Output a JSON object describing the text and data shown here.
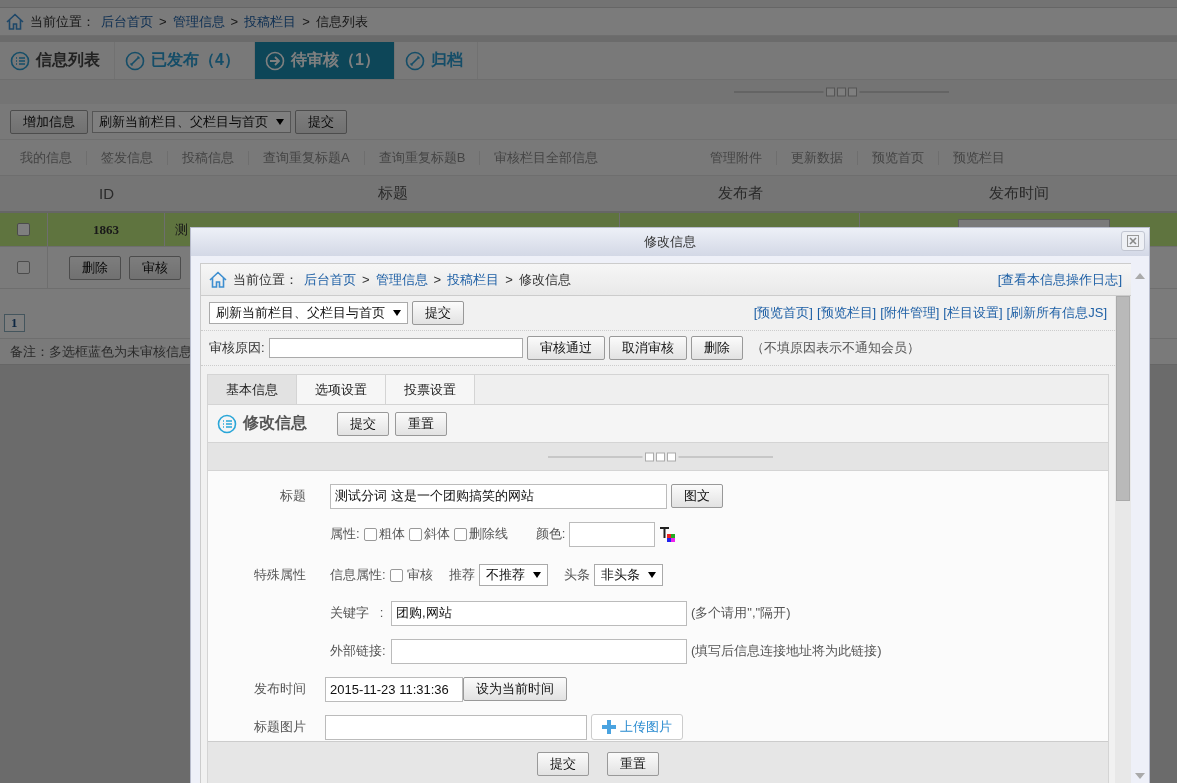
{
  "page": {
    "breadcrumb": {
      "label": "当前位置：",
      "items": [
        {
          "text": "后台首页",
          "kind": "link"
        },
        {
          "text": ">",
          "kind": "separator"
        },
        {
          "text": "管理信息",
          "kind": "link"
        },
        {
          "text": ">",
          "kind": "separator"
        },
        {
          "text": "投稿栏目",
          "kind": "link"
        },
        {
          "text": ">",
          "kind": "separator"
        },
        {
          "text": "信息列表",
          "kind": "current"
        }
      ]
    },
    "tabs": [
      {
        "label": "信息列表",
        "selected": false
      },
      {
        "label": "已发布（4）",
        "selected": false
      },
      {
        "label": "待审核（1）",
        "selected": true
      },
      {
        "label": "归档",
        "selected": false
      }
    ],
    "toolbar": {
      "add_button": "增加信息",
      "refresh_select": "刷新当前栏目、父栏目与首页",
      "submit_button": "提交"
    },
    "links_left": [
      "我的信息",
      "签发信息",
      "投稿信息",
      "查询重复标题A",
      "查询重复标题B",
      "审核栏目全部信息"
    ],
    "links_right": [
      "管理附件",
      "更新数据",
      "预览首页",
      "预览栏目"
    ],
    "table": {
      "columns": [
        "ID",
        "标题",
        "发布者",
        "发布时间"
      ],
      "rows": [
        {
          "checked": false,
          "selected": true,
          "id": "1863",
          "title": "测"
        }
      ],
      "actions": {
        "checked": false,
        "buttons": [
          "删除",
          "审核"
        ]
      }
    },
    "pages": [
      "1"
    ],
    "note": "备注：多选框蓝色为未审核信息"
  },
  "dialog": {
    "title": "修改信息",
    "breadcrumb": {
      "label": "当前位置：",
      "items": [
        {
          "text": "后台首页",
          "kind": "link"
        },
        {
          "text": ">",
          "kind": "separator"
        },
        {
          "text": "管理信息",
          "kind": "link"
        },
        {
          "text": ">",
          "kind": "separator"
        },
        {
          "text": "投稿栏目",
          "kind": "link"
        },
        {
          "text": ">",
          "kind": "separator"
        },
        {
          "text": "修改信息",
          "kind": "current"
        }
      ],
      "log_link": "[查看本信息操作日志]"
    },
    "refresh_select": "刷新当前栏目、父栏目与首页",
    "submit_button": "提交",
    "links": [
      "[预览首页]",
      "[预览栏目]",
      "[附件管理]",
      "[栏目设置]",
      "[刷新所有信息JS]"
    ],
    "review": {
      "label": "审核原因:",
      "buttons": [
        "审核通过",
        "取消审核",
        "删除"
      ],
      "hint": "（不填原因表示不通知会员）"
    },
    "tabs": [
      {
        "label": "基本信息",
        "selected": true
      },
      {
        "label": "选项设置",
        "selected": false
      },
      {
        "label": "投票设置",
        "selected": false
      }
    ],
    "section_title": "修改信息",
    "section_buttons": [
      "提交",
      "重置"
    ],
    "form": {
      "title": {
        "label": "标题",
        "value": "测试分词 这是一个团购搞笑的网站",
        "button": "图文"
      },
      "attributes": {
        "label": "属性:",
        "options": [
          {
            "label": "粗体",
            "checked": false
          },
          {
            "label": "斜体",
            "checked": false
          },
          {
            "label": "删除线",
            "checked": false
          }
        ],
        "color_label": "颜色:"
      },
      "special": {
        "label": "特殊属性",
        "info_label": "信息属性:",
        "review": {
          "label": "审核",
          "checked": false
        },
        "recommend_label": "推荐",
        "recommend_value": "不推荐",
        "headline_label": "头条",
        "headline_value": "非头条"
      },
      "keywords": {
        "label": "关键字   :",
        "value": "团购,网站",
        "hint": "(多个请用\",\"隔开)"
      },
      "external_link": {
        "label": "外部链接:",
        "hint": "(填写后信息连接地址将为此链接)"
      },
      "publish_time": {
        "label": "发布时间",
        "value": "2015-11-23 11:31:36",
        "button": "设为当前时间"
      },
      "title_image": {
        "label": "标题图片",
        "button": "上传图片"
      }
    },
    "footer_buttons": [
      "提交",
      "重置"
    ]
  }
}
